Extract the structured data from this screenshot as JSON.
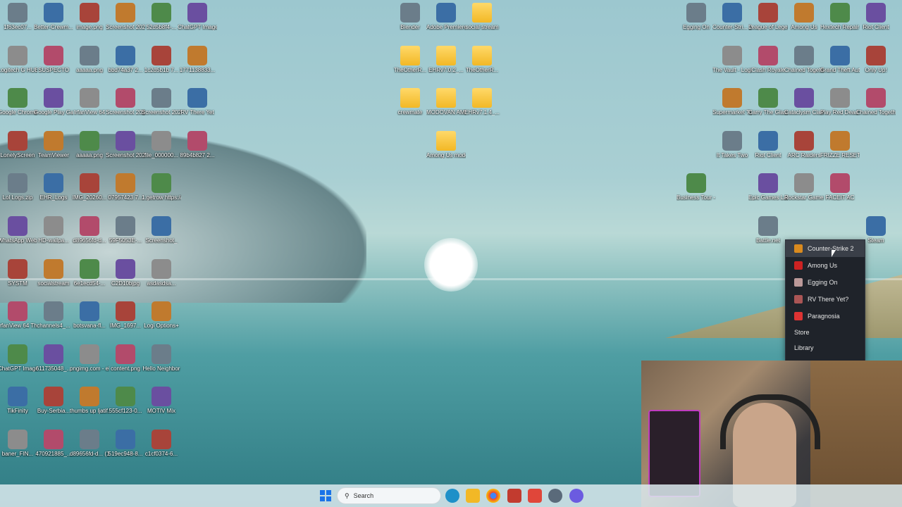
{
  "desktop_icons": [
    {
      "label": "1f63ec07...",
      "col": 0,
      "row": 0
    },
    {
      "label": "Better-Crewm...",
      "col": 1,
      "row": 0
    },
    {
      "label": "image.png",
      "col": 2,
      "row": 0
    },
    {
      "label": "Screenshot 2026-01-...",
      "col": 3,
      "row": 0
    },
    {
      "label": "52d5b8f4-...",
      "col": 4,
      "row": 0
    },
    {
      "label": "ChatGPT Image Jan ...",
      "col": 5,
      "row": 0
    },
    {
      "label": "Logitech G HUB",
      "col": 0,
      "row": 1
    },
    {
      "label": "SUSPECTO",
      "col": 1,
      "row": 1
    },
    {
      "label": "aaaaa.png",
      "col": 2,
      "row": 1
    },
    {
      "label": "bbd74a37 2...",
      "col": 3,
      "row": 1
    },
    {
      "label": "1c2d5b1b 7...",
      "col": 4,
      "row": 1
    },
    {
      "label": "1771138833...",
      "col": 5,
      "row": 1
    },
    {
      "label": "Google Chrome",
      "col": 0,
      "row": 2
    },
    {
      "label": "Google Play Games",
      "col": 1,
      "row": 2
    },
    {
      "label": "IrfanView 64",
      "col": 2,
      "row": 2
    },
    {
      "label": "Screenshot 2026-01-...",
      "col": 3,
      "row": 2
    },
    {
      "label": "Screenshot 2026-01-...",
      "col": 4,
      "row": 2
    },
    {
      "label": "RV There Yet",
      "col": 5,
      "row": 2
    },
    {
      "label": "LonelyScreen",
      "col": 0,
      "row": 3
    },
    {
      "label": "TeamViewer",
      "col": 1,
      "row": 3
    },
    {
      "label": "aaaaa.png",
      "col": 2,
      "row": 3
    },
    {
      "label": "Screenshot 2026-01-...",
      "col": 3,
      "row": 3
    },
    {
      "label": "file_000000...",
      "col": 4,
      "row": 3
    },
    {
      "label": "89b4b827 2...",
      "col": 5,
      "row": 3
    },
    {
      "label": "Lol Logs.zip",
      "col": 0,
      "row": 4
    },
    {
      "label": "EHR_Logs",
      "col": 1,
      "row": 4
    },
    {
      "label": "IMG_20260...",
      "col": 2,
      "row": 4
    },
    {
      "label": "07957423 7...",
      "col": 3,
      "row": 4
    },
    {
      "label": "1.getrow https://www...",
      "col": 4,
      "row": 4
    },
    {
      "label": "WhatsApp Web",
      "col": 0,
      "row": 5
    },
    {
      "label": "HD-wallpa...",
      "col": 1,
      "row": 5
    },
    {
      "label": "d89656fd-d...",
      "col": 2,
      "row": 5
    },
    {
      "label": "59F5053E-...",
      "col": 3,
      "row": 5
    },
    {
      "label": "Screenshot_",
      "col": 4,
      "row": 5
    },
    {
      "label": "SYSTM",
      "col": 0,
      "row": 6
    },
    {
      "label": "socialstream",
      "col": 1,
      "row": 6
    },
    {
      "label": "6e1ecd54-...",
      "col": 2,
      "row": 6
    },
    {
      "label": "C2D10bjpg",
      "col": 3,
      "row": 6
    },
    {
      "label": "asdasdsa...",
      "col": 4,
      "row": 6
    },
    {
      "label": "IrfanView 64 Thumbnails",
      "col": 0,
      "row": 7
    },
    {
      "label": "channels4_...",
      "col": 1,
      "row": 7
    },
    {
      "label": "botsvana-fl...",
      "col": 2,
      "row": 7
    },
    {
      "label": "IMG_1697...",
      "col": 3,
      "row": 7
    },
    {
      "label": "Logi Options+",
      "col": 4,
      "row": 7
    },
    {
      "label": "ChatGPT Image Sep ...",
      "col": 0,
      "row": 8
    },
    {
      "label": "611735048_...",
      "col": 1,
      "row": 8
    },
    {
      "label": "pngimg.com - elephants...",
      "col": 2,
      "row": 8
    },
    {
      "label": "content.png",
      "col": 3,
      "row": 8
    },
    {
      "label": "Hello Neighbor",
      "col": 4,
      "row": 8
    },
    {
      "label": "TikFinity",
      "col": 0,
      "row": 9
    },
    {
      "label": "Buy-Serbia...",
      "col": 1,
      "row": 9
    },
    {
      "label": "thumbs up ljatif.jpg",
      "col": 2,
      "row": 9
    },
    {
      "label": "555cf123-0...",
      "col": 3,
      "row": 9
    },
    {
      "label": "MOTIV Mix",
      "col": 4,
      "row": 9
    },
    {
      "label": "baner_FIN...",
      "col": 0,
      "row": 10
    },
    {
      "label": "470921885_...",
      "col": 1,
      "row": 10
    },
    {
      "label": "d89656fd-d... (1).webp",
      "col": 2,
      "row": 10
    },
    {
      "label": "519ec948-8...",
      "col": 3,
      "row": 10
    },
    {
      "label": "c1cf0374-6...",
      "col": 4,
      "row": 10
    }
  ],
  "center_icons": [
    {
      "label": "Blender",
      "col": 0,
      "row": 0,
      "folder": false
    },
    {
      "label": "Adobe Premiere P...",
      "col": 1,
      "row": 0,
      "folder": false
    },
    {
      "label": "social stream",
      "col": 2,
      "row": 0,
      "folder": true
    },
    {
      "label": "TheOtherR...",
      "col": 0,
      "row": 1,
      "folder": true
    },
    {
      "label": "EHRv7.0.2_...",
      "col": 1,
      "row": 1,
      "folder": true
    },
    {
      "label": "TheOtherR...",
      "col": 2,
      "row": 1,
      "folder": true
    },
    {
      "label": "crewmate",
      "col": 0,
      "row": 2,
      "folder": true
    },
    {
      "label": "MODOVAN AMONG US",
      "col": 1,
      "row": 2,
      "folder": true
    },
    {
      "label": "EHRv7.1.4_...",
      "col": 2,
      "row": 2,
      "folder": true
    },
    {
      "label": "Among Us modovani 7",
      "col": 1,
      "row": 3,
      "folder": true
    }
  ],
  "right_icons": [
    {
      "label": "Egging On",
      "col": 0,
      "row": 0
    },
    {
      "label": "Counter-Stri... 2",
      "col": 1,
      "row": 0
    },
    {
      "label": "League of Legends",
      "col": 2,
      "row": 0
    },
    {
      "label": "Among Us",
      "col": 3,
      "row": 0
    },
    {
      "label": "Hextech Repair Tool",
      "col": 4,
      "row": 0
    },
    {
      "label": "Riot Client",
      "col": 5,
      "row": 0
    },
    {
      "label": "The Vault - Logic Puzz...",
      "col": 1,
      "row": 1
    },
    {
      "label": "Clash Royale",
      "col": 2,
      "row": 1
    },
    {
      "label": "Chained Together",
      "col": 3,
      "row": 1
    },
    {
      "label": "Grand Theft Auto V",
      "col": 4,
      "row": 1
    },
    {
      "label": "Only Up!",
      "col": 5,
      "row": 1
    },
    {
      "label": "Supermarket Together",
      "col": 1,
      "row": 2
    },
    {
      "label": "Carry The Glass",
      "col": 2,
      "row": 2
    },
    {
      "label": "Cataclysm Classic",
      "col": 3,
      "row": 2
    },
    {
      "label": "Play Red Dead Rede...",
      "col": 4,
      "row": 2
    },
    {
      "label": "Chained Togethe...",
      "col": 5,
      "row": 2
    },
    {
      "label": "It Takes Two",
      "col": 1,
      "row": 3
    },
    {
      "label": "Riot Client",
      "col": 2,
      "row": 3
    },
    {
      "label": "ARC Raiders",
      "col": 3,
      "row": 3
    },
    {
      "label": "FRIZZE RESET STREMIO (1)",
      "col": 4,
      "row": 3
    },
    {
      "label": "Business Tour - Online M...",
      "col": 0,
      "row": 4
    },
    {
      "label": "Epic Games Launcher",
      "col": 2,
      "row": 4
    },
    {
      "label": "Rockstar Games ...",
      "col": 3,
      "row": 4
    },
    {
      "label": "FACEIT AC",
      "col": 4,
      "row": 4
    },
    {
      "label": "Battle.net",
      "col": 2,
      "row": 5
    },
    {
      "label": "Steam",
      "col": 5,
      "row": 5
    }
  ],
  "context_menu": {
    "games": [
      {
        "label": "Counter-Strike 2",
        "color": "#d98a1e"
      },
      {
        "label": "Among Us",
        "color": "#c22"
      },
      {
        "label": "Egging On",
        "color": "#b99"
      },
      {
        "label": "RV There Yet?",
        "color": "#a55"
      },
      {
        "label": "Paragnosia",
        "color": "#d33"
      }
    ],
    "store": "Store",
    "library": "Library"
  },
  "taskbar": {
    "search_placeholder": "Search"
  },
  "colors": {
    "menu_bg": "#1f232a",
    "menu_active": "#3a3f48",
    "taskbar_bg": "#dceaee"
  }
}
